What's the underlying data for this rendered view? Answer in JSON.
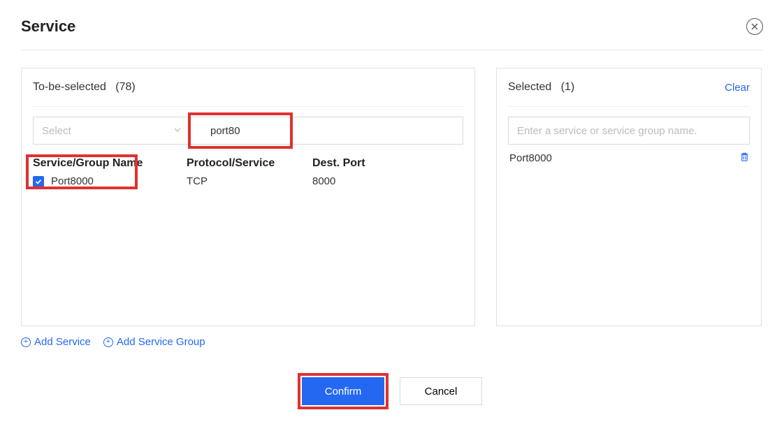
{
  "dialog": {
    "title": "Service"
  },
  "left": {
    "header_label": "To-be-selected",
    "header_count": "(78)",
    "select_placeholder": "Select",
    "search_value": "port80",
    "columns": {
      "name": "Service/Group Name",
      "protocol": "Protocol/Service",
      "port": "Dest. Port"
    },
    "rows": [
      {
        "checked": true,
        "name": "Port8000",
        "protocol": "TCP",
        "port": "8000"
      }
    ],
    "add_service": "Add Service",
    "add_group": "Add Service Group"
  },
  "right": {
    "header_label": "Selected",
    "header_count": "(1)",
    "clear": "Clear",
    "search_placeholder": "Enter a service or service group name.",
    "items": [
      {
        "name": "Port8000"
      }
    ]
  },
  "footer": {
    "confirm": "Confirm",
    "cancel": "Cancel"
  }
}
